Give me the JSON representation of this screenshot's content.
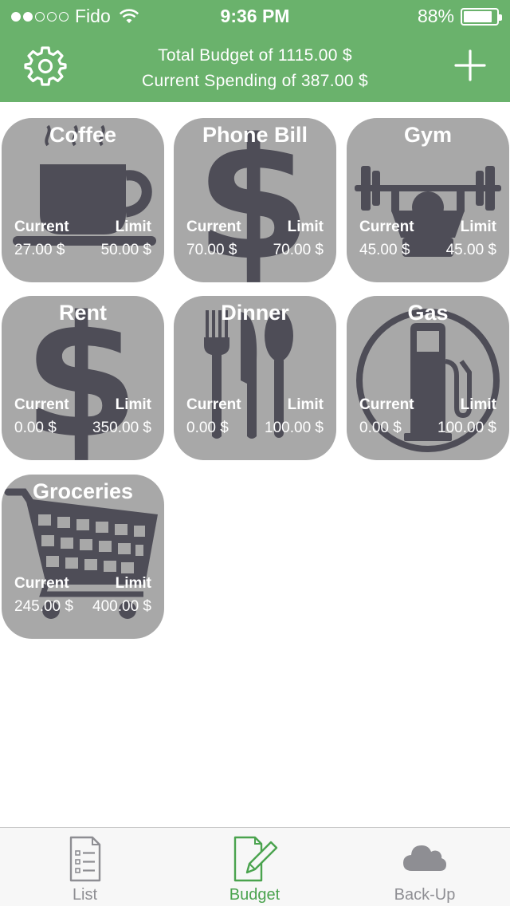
{
  "status_bar": {
    "carrier": "Fido",
    "time": "9:36 PM",
    "battery": "88%",
    "battery_level": 0.88
  },
  "header": {
    "total_budget": "Total Budget of 1115.00 $",
    "current_spending": "Current Spending of 387.00 $"
  },
  "categories": [
    {
      "name": "Coffee",
      "icon": "coffee-cup-icon",
      "current_label": "Current",
      "limit_label": "Limit",
      "current": "27.00 $",
      "limit": "50.00 $"
    },
    {
      "name": "Phone Bill",
      "icon": "dollar-icon",
      "current_label": "Current",
      "limit_label": "Limit",
      "current": "70.00 $",
      "limit": "70.00 $"
    },
    {
      "name": "Gym",
      "icon": "weightlifter-icon",
      "current_label": "Current",
      "limit_label": "Limit",
      "current": "45.00 $",
      "limit": "45.00 $"
    },
    {
      "name": "Rent",
      "icon": "dollar-icon",
      "current_label": "Current",
      "limit_label": "Limit",
      "current": "0.00 $",
      "limit": "350.00 $"
    },
    {
      "name": "Dinner",
      "icon": "cutlery-icon",
      "current_label": "Current",
      "limit_label": "Limit",
      "current": "0.00 $",
      "limit": "100.00 $"
    },
    {
      "name": "Gas",
      "icon": "gas-pump-icon",
      "current_label": "Current",
      "limit_label": "Limit",
      "current": "0.00 $",
      "limit": "100.00 $"
    },
    {
      "name": "Groceries",
      "icon": "shopping-cart-icon",
      "current_label": "Current",
      "limit_label": "Limit",
      "current": "245.00 $",
      "limit": "400.00 $"
    }
  ],
  "tabs": [
    {
      "label": "List",
      "icon": "list-document-icon",
      "active": false
    },
    {
      "label": "Budget",
      "icon": "edit-document-icon",
      "active": true
    },
    {
      "label": "Back-Up",
      "icon": "cloud-icon",
      "active": false
    }
  ],
  "colors": {
    "header": "#6ab26c",
    "tile": "#a8a8a8",
    "icon": "#4e4d57",
    "active_tab": "#4aa34e",
    "inactive_tab": "#8e8e93"
  }
}
